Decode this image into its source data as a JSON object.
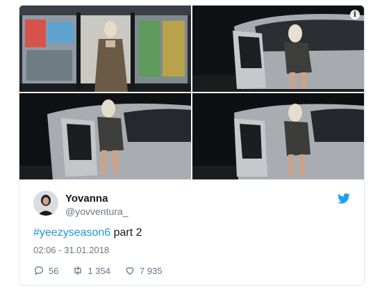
{
  "tweet": {
    "display_name": "Yovanna",
    "handle": "@yovventura_",
    "hashtag": "#yeezyseason6",
    "text_rest": " part 2",
    "timestamp": "02:06 - 31.01.2018"
  },
  "actions": {
    "replies": "56",
    "retweets": "1 354",
    "likes": "7 935"
  },
  "media": {
    "info_glyph": "i",
    "tiles": [
      {
        "scene": "convenience-store-entrance"
      },
      {
        "scene": "car-door-night"
      },
      {
        "scene": "car-door-night"
      },
      {
        "scene": "car-door-night"
      }
    ]
  },
  "colors": {
    "accent": "#1b95e0",
    "text": "#14171a",
    "secondary": "#657786",
    "border": "#e1e8ed"
  },
  "icons": [
    "info-icon",
    "twitter-bird-icon",
    "reply-icon",
    "retweet-icon",
    "like-icon"
  ]
}
